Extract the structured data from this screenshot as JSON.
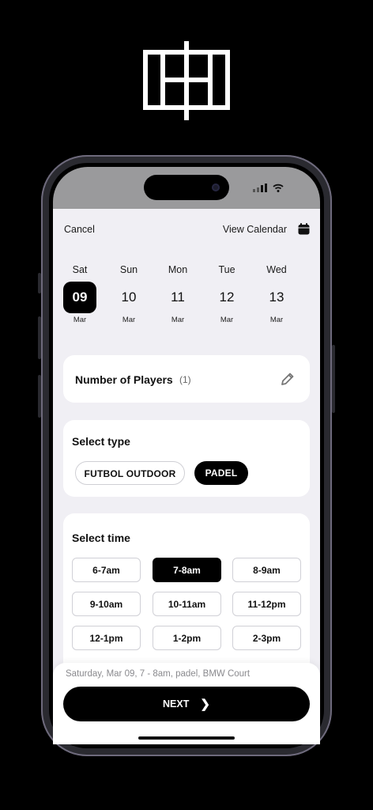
{
  "topbar": {
    "cancel_label": "Cancel",
    "view_calendar_label": "View Calendar"
  },
  "days": [
    {
      "name": "Sat",
      "num": "09",
      "month": "Mar",
      "selected": true
    },
    {
      "name": "Sun",
      "num": "10",
      "month": "Mar",
      "selected": false
    },
    {
      "name": "Mon",
      "num": "11",
      "month": "Mar",
      "selected": false
    },
    {
      "name": "Tue",
      "num": "12",
      "month": "Mar",
      "selected": false
    },
    {
      "name": "Wed",
      "num": "13",
      "month": "Mar",
      "selected": false
    }
  ],
  "players": {
    "title": "Number of Players",
    "count": "(1)"
  },
  "type_section": {
    "title": "Select type",
    "options": [
      {
        "label": "FUTBOL OUTDOOR",
        "selected": false
      },
      {
        "label": "PADEL",
        "selected": true
      }
    ]
  },
  "time_section": {
    "title": "Select time",
    "slots": [
      {
        "label": "6-7am",
        "selected": false
      },
      {
        "label": "7-8am",
        "selected": true
      },
      {
        "label": "8-9am",
        "selected": false
      },
      {
        "label": "9-10am",
        "selected": false
      },
      {
        "label": "10-11am",
        "selected": false
      },
      {
        "label": "11-12pm",
        "selected": false
      },
      {
        "label": "12-1pm",
        "selected": false
      },
      {
        "label": "1-2pm",
        "selected": false
      },
      {
        "label": "2-3pm",
        "selected": false
      }
    ]
  },
  "footer": {
    "summary": "Saturday, Mar 09, 7 - 8am, padel, BMW Court",
    "next_label": "NEXT"
  },
  "icons": {
    "logo": "court-logo-icon",
    "calendar": "calendar-icon",
    "edit": "pencil-icon",
    "next": "chevron-right-icon"
  },
  "colors": {
    "accent": "#000000",
    "background": "#f0eff4",
    "card": "#ffffff"
  }
}
